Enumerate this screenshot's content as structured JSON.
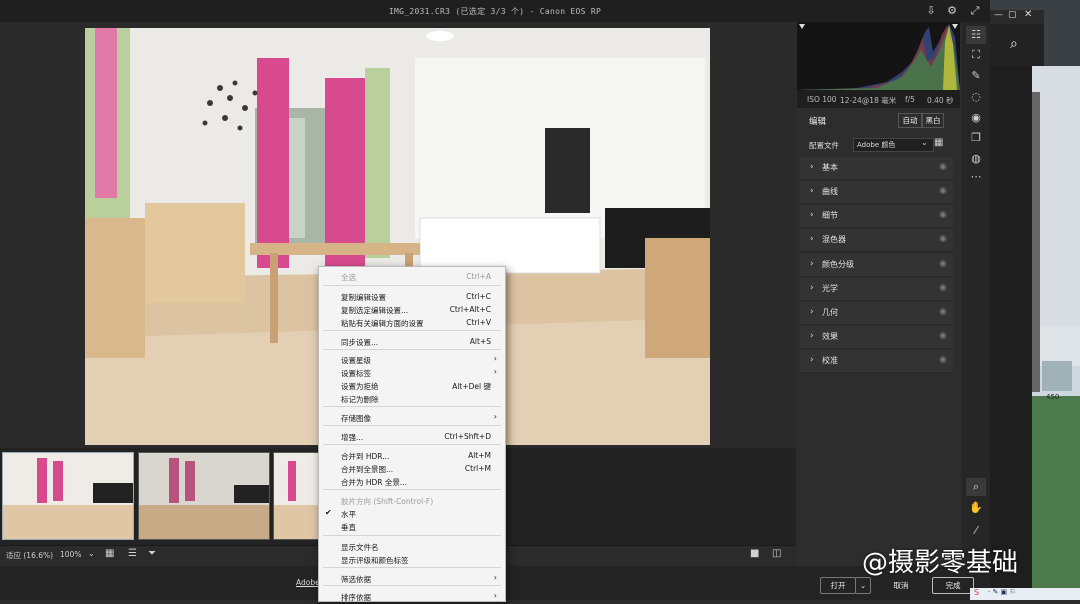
{
  "window": {
    "title": "IMG_2031.CR3 (已选定 3/3 个) - Canon EOS RP"
  },
  "exif": {
    "iso": "ISO 100",
    "focal": "12-24@18 毫米",
    "aperture": "f/5",
    "shutter": "0.40 秒"
  },
  "edit_panel": {
    "title": "编辑",
    "auto_label": "自动",
    "bw_label": "黑白",
    "profile_label": "配置文件",
    "profile_value": "Adobe 颜色",
    "sections": [
      "基本",
      "曲线",
      "细节",
      "混色器",
      "颜色分级",
      "光学",
      "几何",
      "效果",
      "校准"
    ]
  },
  "status": {
    "fit_label": "适应 (16.6%)",
    "zoom_value": "100%"
  },
  "bottom": {
    "adobe_link": "Adobe",
    "open_label": "打开",
    "cancel_label": "取消",
    "done_label": "完成"
  },
  "bg_window": {
    "number": "450"
  },
  "context_menu": {
    "items": [
      {
        "label": "全选",
        "shortcut": "Ctrl+A",
        "disabled": true
      },
      {
        "label": "复制编辑设置",
        "shortcut": "Ctrl+C"
      },
      {
        "label": "复制选定编辑设置...",
        "shortcut": "Ctrl+Alt+C"
      },
      {
        "label": "粘贴有关编辑方面的设置",
        "shortcut": "Ctrl+V"
      },
      {
        "label": "同步设置...",
        "shortcut": "Alt+S"
      },
      {
        "label": "设置星级",
        "shortcut": ""
      },
      {
        "label": "设置标签",
        "shortcut": ""
      },
      {
        "label": "设置为拒绝",
        "shortcut": "Alt+Del 键"
      },
      {
        "label": "标记为删除",
        "shortcut": ""
      },
      {
        "label": "存储图像",
        "shortcut": ""
      },
      {
        "label": "增强...",
        "shortcut": "Ctrl+Shft+D"
      },
      {
        "label": "合并到 HDR...",
        "shortcut": "Alt+M"
      },
      {
        "label": "合并到全景图...",
        "shortcut": "Ctrl+M"
      },
      {
        "label": "合并为 HDR 全景...",
        "shortcut": ""
      },
      {
        "label": "胶片方向 (Shift-Control-F)",
        "shortcut": "",
        "disabled": true
      },
      {
        "label": "水平",
        "shortcut": "",
        "checked": true
      },
      {
        "label": "垂直",
        "shortcut": ""
      },
      {
        "label": "显示文件名",
        "shortcut": ""
      },
      {
        "label": "显示评级和颜色标签",
        "shortcut": ""
      },
      {
        "label": "筛选依据",
        "shortcut": ""
      },
      {
        "label": "排序依据",
        "shortcut": ""
      }
    ]
  },
  "watermark": {
    "text": "@摄影零基础"
  },
  "colors": {
    "panel": "#2d2d2d",
    "section": "#333333",
    "menu_bg": "#f4f4f4"
  }
}
